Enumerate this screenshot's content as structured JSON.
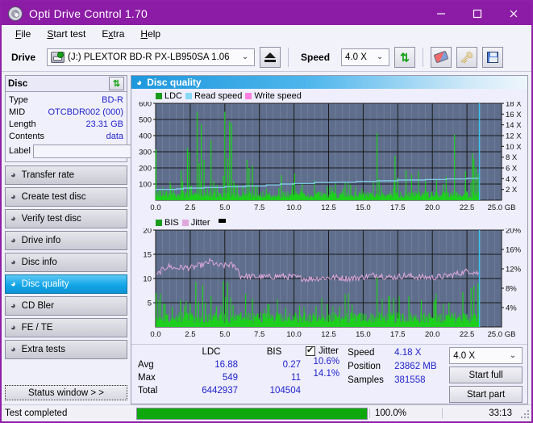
{
  "window": {
    "title": "Opti Drive Control 1.70",
    "icon": "disc-icon",
    "minimize": "minimize-icon",
    "maximize": "maximize-icon",
    "close": "close-icon"
  },
  "menu": [
    {
      "label": "File",
      "accel": "F"
    },
    {
      "label": "Start test",
      "accel": "S"
    },
    {
      "label": "Extra",
      "accel": "x"
    },
    {
      "label": "Help",
      "accel": "H"
    }
  ],
  "toolbar": {
    "drive_label": "Drive",
    "drive_value": "(J:)  PLEXTOR BD-R  PX-LB950SA 1.06",
    "eject_icon": "eject-icon",
    "speed_label": "Speed",
    "speed_value": "4.0 X",
    "refresh_icon": "refresh-icon",
    "erase_icon": "eraser-icon",
    "key_icon": "key-icon",
    "save_icon": "save-icon"
  },
  "disc_panel": {
    "title": "Disc",
    "refresh_icon": "refresh-icon",
    "rows": [
      {
        "key": "Type",
        "value": "BD-R"
      },
      {
        "key": "MID",
        "value": "OTCBDR002 (000)"
      },
      {
        "key": "Length",
        "value": "23.31 GB"
      },
      {
        "key": "Contents",
        "value": "data"
      }
    ],
    "label_key": "Label",
    "label_value": "",
    "label_placeholder": "",
    "disc_button_icon": "cd-icon"
  },
  "sidebar": {
    "items": [
      {
        "label": "Transfer rate",
        "icon": "disc-icon",
        "active": false
      },
      {
        "label": "Create test disc",
        "icon": "disc-icon",
        "active": false
      },
      {
        "label": "Verify test disc",
        "icon": "disc-icon",
        "active": false
      },
      {
        "label": "Drive info",
        "icon": "disc-icon",
        "active": false
      },
      {
        "label": "Disc info",
        "icon": "disc-icon",
        "active": false
      },
      {
        "label": "Disc quality",
        "icon": "disc-icon",
        "active": true
      },
      {
        "label": "CD Bler",
        "icon": "disc-icon",
        "active": false
      },
      {
        "label": "FE / TE",
        "icon": "disc-icon",
        "active": false
      },
      {
        "label": "Extra tests",
        "icon": "disc-icon",
        "active": false
      }
    ],
    "status_window": "Status window > >"
  },
  "panel": {
    "title": "Disc quality",
    "icon": "disc-icon"
  },
  "stats": {
    "headers": [
      "",
      "LDC",
      "BIS"
    ],
    "rows": [
      {
        "label": "Avg",
        "ldc": "16.88",
        "bis": "0.27"
      },
      {
        "label": "Max",
        "ldc": "549",
        "bis": "11"
      },
      {
        "label": "Total",
        "ldc": "6442937",
        "bis": "104504"
      }
    ],
    "jitter_label": "Jitter",
    "jitter_checked": true,
    "jitter_avg": "10.6%",
    "jitter_max": "14.1%",
    "speed_label": "Speed",
    "speed_value": "4.18 X",
    "position_label": "Position",
    "position_value": "23862 MB",
    "samples_label": "Samples",
    "samples_value": "381558",
    "speed_select": "4.0 X",
    "start_full": "Start full",
    "start_part": "Start part"
  },
  "statusbar": {
    "text": "Test completed",
    "percent": "100.0%",
    "progress": 100,
    "time": "33:13"
  },
  "colors": {
    "accent": "#8c1ba6",
    "ldc_green": "#1ecf1e",
    "read_speed": "#87d7f7",
    "write_speed": "#ff7fe0",
    "jitter_pink": "#e0a8dc",
    "plot_bg": "#5f6e8c",
    "header_blue": "#1d97dd",
    "value_blue": "#2222cc",
    "progress_green": "#0ea80e"
  },
  "chart_data": [
    {
      "type": "line",
      "name": "ldc-chart",
      "title": "",
      "xlabel": "GB",
      "ylabel": "",
      "xlim": [
        0,
        25
      ],
      "ylim": [
        0,
        600
      ],
      "y2lim": [
        0,
        18
      ],
      "grid": true,
      "legend_position": "top-left",
      "legend": [
        {
          "label": "LDC",
          "color": "#1c9c1c"
        },
        {
          "label": "Read speed",
          "color": "#87d7f7"
        },
        {
          "label": "Write speed",
          "color": "#ff7fe0"
        }
      ],
      "xticks": [
        "0.0",
        "2.5",
        "5.0",
        "7.5",
        "10.0",
        "12.5",
        "15.0",
        "17.5",
        "20.0",
        "22.5",
        "25.0 GB"
      ],
      "yticks": [
        "100",
        "200",
        "300",
        "400",
        "500",
        "600"
      ],
      "y2ticks": [
        "2 X",
        "4 X",
        "6 X",
        "8 X",
        "10 X",
        "12 X",
        "14 X",
        "16 X",
        "18 X"
      ],
      "data_end_gb": 23.4,
      "series": [
        {
          "name": "LDC",
          "color": "#1ecf1e",
          "style": "bars",
          "baseline_avg": 40,
          "spikes": [
            {
              "x": 0.02,
              "y": 315
            },
            {
              "x": 0.3,
              "y": 70
            },
            {
              "x": 0.8,
              "y": 60
            },
            {
              "x": 1.3,
              "y": 75
            },
            {
              "x": 1.85,
              "y": 185
            },
            {
              "x": 1.95,
              "y": 120
            },
            {
              "x": 2.3,
              "y": 325
            },
            {
              "x": 2.45,
              "y": 300
            },
            {
              "x": 2.6,
              "y": 90
            },
            {
              "x": 3.0,
              "y": 548
            },
            {
              "x": 3.15,
              "y": 230
            },
            {
              "x": 3.3,
              "y": 470
            },
            {
              "x": 3.5,
              "y": 250
            },
            {
              "x": 3.75,
              "y": 80
            },
            {
              "x": 4.0,
              "y": 370
            },
            {
              "x": 4.2,
              "y": 120
            },
            {
              "x": 4.45,
              "y": 95
            },
            {
              "x": 4.9,
              "y": 150
            },
            {
              "x": 5.0,
              "y": 548
            },
            {
              "x": 5.2,
              "y": 260
            },
            {
              "x": 5.35,
              "y": 490
            },
            {
              "x": 5.5,
              "y": 475
            },
            {
              "x": 5.65,
              "y": 120
            },
            {
              "x": 5.9,
              "y": 95
            },
            {
              "x": 6.3,
              "y": 90
            },
            {
              "x": 6.6,
              "y": 250
            },
            {
              "x": 6.75,
              "y": 200
            },
            {
              "x": 7.0,
              "y": 215
            },
            {
              "x": 7.2,
              "y": 85
            },
            {
              "x": 8.0,
              "y": 70
            },
            {
              "x": 8.9,
              "y": 75
            },
            {
              "x": 9.1,
              "y": 155
            },
            {
              "x": 9.9,
              "y": 105
            },
            {
              "x": 10.05,
              "y": 165
            },
            {
              "x": 10.5,
              "y": 70
            },
            {
              "x": 11.5,
              "y": 65
            },
            {
              "x": 12.4,
              "y": 85
            },
            {
              "x": 13.0,
              "y": 90
            },
            {
              "x": 13.6,
              "y": 75
            },
            {
              "x": 14.1,
              "y": 95
            },
            {
              "x": 16.0,
              "y": 415
            },
            {
              "x": 16.15,
              "y": 130
            },
            {
              "x": 17.3,
              "y": 275
            },
            {
              "x": 17.5,
              "y": 140
            },
            {
              "x": 18.1,
              "y": 185
            },
            {
              "x": 18.5,
              "y": 160
            },
            {
              "x": 19.0,
              "y": 180
            },
            {
              "x": 19.5,
              "y": 120
            },
            {
              "x": 20.3,
              "y": 130
            },
            {
              "x": 21.0,
              "y": 145
            },
            {
              "x": 21.6,
              "y": 405
            },
            {
              "x": 22.4,
              "y": 180
            },
            {
              "x": 22.9,
              "y": 290
            },
            {
              "x": 23.0,
              "y": 255
            },
            {
              "x": 23.15,
              "y": 205
            },
            {
              "x": 23.3,
              "y": 165
            }
          ]
        },
        {
          "name": "Read speed",
          "color": "#87d7f7",
          "style": "line",
          "points": [
            {
              "x": 0.0,
              "y": 2.0
            },
            {
              "x": 1.5,
              "y": 2.1
            },
            {
              "x": 2.0,
              "y": 2.25
            },
            {
              "x": 3.5,
              "y": 2.35
            },
            {
              "x": 5.0,
              "y": 2.5
            },
            {
              "x": 6.5,
              "y": 2.65
            },
            {
              "x": 8.0,
              "y": 2.85
            },
            {
              "x": 9.0,
              "y": 3.0
            },
            {
              "x": 10.0,
              "y": 3.1
            },
            {
              "x": 11.5,
              "y": 3.3
            },
            {
              "x": 13.0,
              "y": 3.35
            },
            {
              "x": 14.5,
              "y": 3.5
            },
            {
              "x": 16.0,
              "y": 3.6
            },
            {
              "x": 17.5,
              "y": 3.75
            },
            {
              "x": 19.5,
              "y": 3.85
            },
            {
              "x": 21.0,
              "y": 3.95
            },
            {
              "x": 22.5,
              "y": 4.05
            },
            {
              "x": 23.4,
              "y": 4.18
            }
          ]
        },
        {
          "name": "cursor",
          "color": "#38c8f0",
          "style": "vline",
          "x": 23.4
        }
      ]
    },
    {
      "type": "line",
      "name": "bis-jitter-chart",
      "title": "",
      "xlabel": "GB",
      "ylabel": "",
      "xlim": [
        0,
        25
      ],
      "ylim": [
        0,
        20
      ],
      "y2lim": [
        0,
        20
      ],
      "grid": true,
      "legend_position": "top-left",
      "legend": [
        {
          "label": "BIS",
          "color": "#1c9c1c"
        },
        {
          "label": "Jitter",
          "color": "#e0a8dc"
        }
      ],
      "xticks": [
        "0.0",
        "2.5",
        "5.0",
        "7.5",
        "10.0",
        "12.5",
        "15.0",
        "17.5",
        "20.0",
        "22.5",
        "25.0 GB"
      ],
      "yticks": [
        "5",
        "10",
        "15",
        "20"
      ],
      "y2ticks": [
        "4%",
        "8%",
        "12%",
        "16%",
        "20%"
      ],
      "data_end_gb": 23.4,
      "series": [
        {
          "name": "BIS",
          "color": "#1ecf1e",
          "style": "bars",
          "baseline_avg": 2.2,
          "spikes": [
            {
              "x": 0.05,
              "y": 7.0
            },
            {
              "x": 0.6,
              "y": 4.8
            },
            {
              "x": 1.2,
              "y": 4.2
            },
            {
              "x": 1.8,
              "y": 5.6
            },
            {
              "x": 2.1,
              "y": 4.4
            },
            {
              "x": 2.5,
              "y": 4.9
            },
            {
              "x": 2.9,
              "y": 9.3
            },
            {
              "x": 3.1,
              "y": 5.2
            },
            {
              "x": 3.4,
              "y": 8.6
            },
            {
              "x": 3.6,
              "y": 5.0
            },
            {
              "x": 4.0,
              "y": 6.4
            },
            {
              "x": 4.4,
              "y": 4.3
            },
            {
              "x": 4.9,
              "y": 9.5
            },
            {
              "x": 5.05,
              "y": 6.2
            },
            {
              "x": 5.2,
              "y": 9.3
            },
            {
              "x": 5.6,
              "y": 4.5
            },
            {
              "x": 6.5,
              "y": 6.8
            },
            {
              "x": 7.0,
              "y": 5.9
            },
            {
              "x": 8.2,
              "y": 4.6
            },
            {
              "x": 9.4,
              "y": 4.0
            },
            {
              "x": 10.4,
              "y": 4.4
            },
            {
              "x": 11.6,
              "y": 4.3
            },
            {
              "x": 12.4,
              "y": 4.7
            },
            {
              "x": 13.3,
              "y": 4.2
            },
            {
              "x": 14.2,
              "y": 4.5
            },
            {
              "x": 16.0,
              "y": 10.2
            },
            {
              "x": 17.2,
              "y": 6.0
            },
            {
              "x": 18.3,
              "y": 6.3
            },
            {
              "x": 19.2,
              "y": 5.5
            },
            {
              "x": 20.2,
              "y": 5.8
            },
            {
              "x": 21.2,
              "y": 5.0
            },
            {
              "x": 22.2,
              "y": 7.2
            },
            {
              "x": 22.8,
              "y": 8.0
            },
            {
              "x": 23.0,
              "y": 8.5
            },
            {
              "x": 23.3,
              "y": 9.0
            }
          ]
        },
        {
          "name": "Jitter",
          "color": "#e0a8dc",
          "style": "line",
          "points": [
            {
              "x": 0.0,
              "y": 10.3
            },
            {
              "x": 0.4,
              "y": 11.6
            },
            {
              "x": 0.9,
              "y": 12.6
            },
            {
              "x": 1.4,
              "y": 12.1
            },
            {
              "x": 2.0,
              "y": 12.3
            },
            {
              "x": 2.6,
              "y": 12.2
            },
            {
              "x": 3.1,
              "y": 12.6
            },
            {
              "x": 3.6,
              "y": 13.0
            },
            {
              "x": 4.0,
              "y": 13.6
            },
            {
              "x": 4.4,
              "y": 12.7
            },
            {
              "x": 4.9,
              "y": 12.6
            },
            {
              "x": 5.4,
              "y": 12.9
            },
            {
              "x": 5.9,
              "y": 12.2
            },
            {
              "x": 6.1,
              "y": 10.5
            },
            {
              "x": 7.0,
              "y": 10.4
            },
            {
              "x": 8.0,
              "y": 10.3
            },
            {
              "x": 9.0,
              "y": 10.5
            },
            {
              "x": 10.0,
              "y": 10.3
            },
            {
              "x": 11.0,
              "y": 9.9
            },
            {
              "x": 12.0,
              "y": 10.1
            },
            {
              "x": 13.0,
              "y": 10.2
            },
            {
              "x": 14.0,
              "y": 10.0
            },
            {
              "x": 15.0,
              "y": 10.3
            },
            {
              "x": 16.0,
              "y": 10.8
            },
            {
              "x": 17.0,
              "y": 10.2
            },
            {
              "x": 18.0,
              "y": 10.6
            },
            {
              "x": 19.0,
              "y": 10.3
            },
            {
              "x": 20.0,
              "y": 10.2
            },
            {
              "x": 21.0,
              "y": 10.5
            },
            {
              "x": 22.0,
              "y": 11.1
            },
            {
              "x": 22.6,
              "y": 11.6
            },
            {
              "x": 23.4,
              "y": 11.0
            }
          ]
        },
        {
          "name": "cursor",
          "color": "#38c8f0",
          "style": "vline",
          "x": 23.4
        }
      ]
    }
  ]
}
